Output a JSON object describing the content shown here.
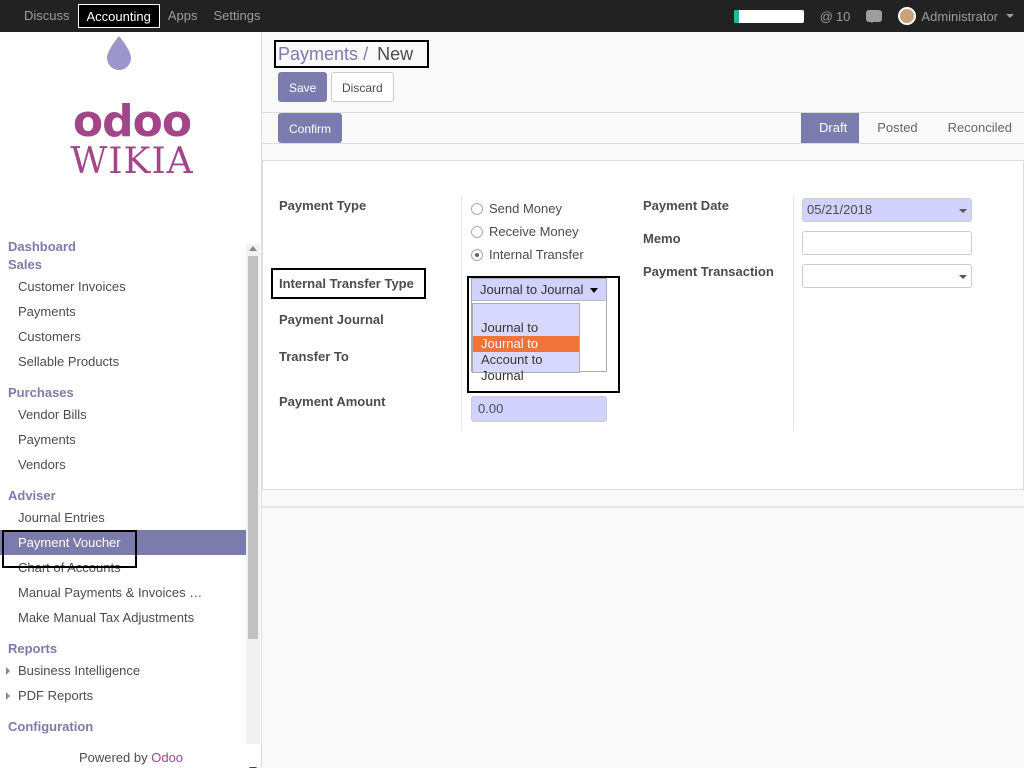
{
  "topbar": {
    "menu": [
      "Discuss",
      "Accounting",
      "Apps",
      "Settings"
    ],
    "active_index": 1,
    "progress_fraction": 0.08,
    "mentions": "10",
    "user": "Administrator"
  },
  "sidebar": {
    "logo_top": "odoo",
    "logo_bottom": "WIKIA",
    "sections": [
      {
        "title": "Dashboard",
        "items": []
      },
      {
        "title": "Sales",
        "items": [
          "Customer Invoices",
          "Payments",
          "Customers",
          "Sellable Products"
        ]
      },
      {
        "title": "Purchases",
        "items": [
          "Vendor Bills",
          "Payments",
          "Vendors"
        ]
      },
      {
        "title": "Adviser",
        "items": [
          "Journal Entries",
          "Payment Voucher",
          "Chart of Accounts",
          "Manual Payments & Invoices …",
          "Make Manual Tax Adjustments"
        ]
      },
      {
        "title": "Reports",
        "items": [
          "Business Intelligence",
          "PDF Reports"
        ]
      },
      {
        "title": "Configuration",
        "items": []
      }
    ],
    "active_item": "Payment Voucher",
    "powered_prefix": "Powered by",
    "powered_brand": "Odoo"
  },
  "control": {
    "breadcrumb_parent": "Payments",
    "breadcrumb_sep": "/",
    "breadcrumb_current": "New",
    "save": "Save",
    "discard": "Discard",
    "confirm": "Confirm",
    "stages": [
      "Draft",
      "Posted",
      "Reconciled"
    ],
    "current_stage": "Draft"
  },
  "form": {
    "payment_type_label": "Payment Type",
    "payment_types": [
      "Send Money",
      "Receive Money",
      "Internal Transfer"
    ],
    "payment_type_selected": "Internal Transfer",
    "transfer_type_label": "Internal Transfer Type",
    "transfer_type_value": "Journal to Journal",
    "transfer_type_options": [
      "",
      "Journal to Journal",
      "Journal to Account",
      "Account to Journal"
    ],
    "transfer_type_highlighted": "Journal to Account",
    "payment_journal_label": "Payment Journal",
    "transfer_to_label": "Transfer To",
    "payment_amount_label": "Payment Amount",
    "payment_amount_value": "0.00",
    "payment_date_label": "Payment Date",
    "payment_date_value": "05/21/2018",
    "memo_label": "Memo",
    "memo_value": "",
    "payment_transaction_label": "Payment Transaction",
    "payment_transaction_value": ""
  }
}
